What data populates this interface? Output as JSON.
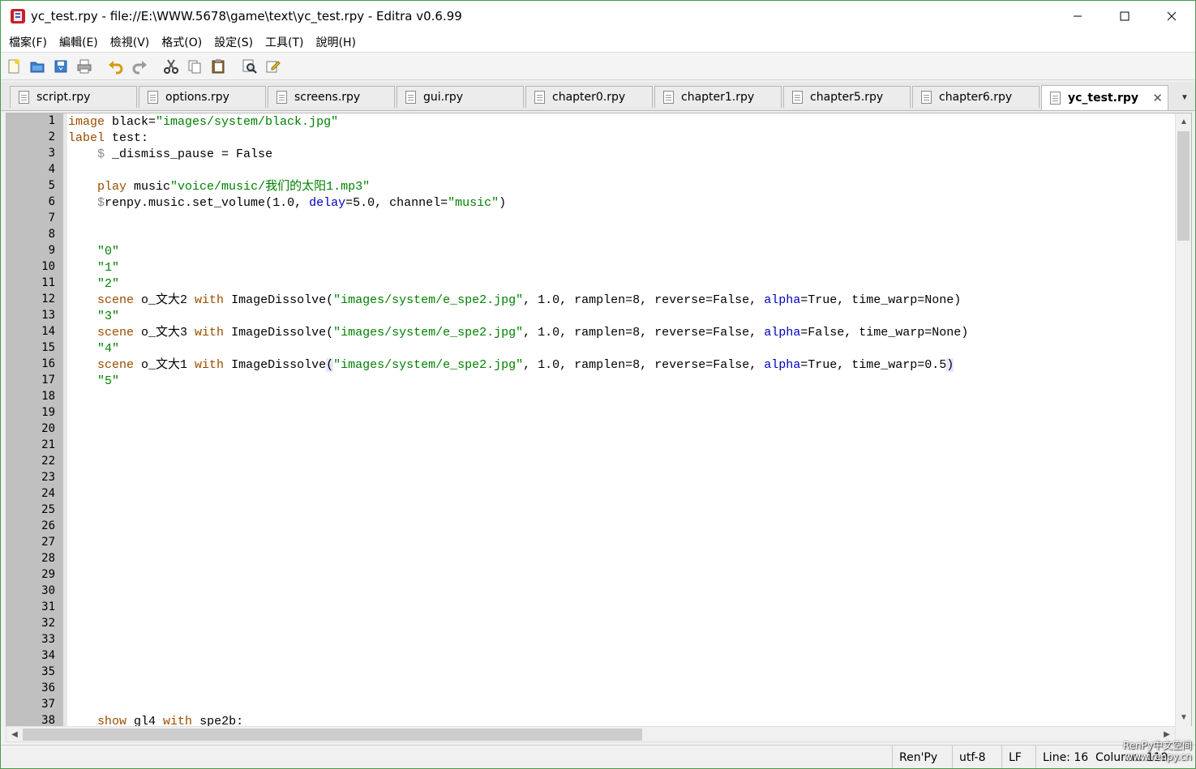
{
  "window": {
    "title": "yc_test.rpy - file://E:\\WWW.5678\\game\\text\\yc_test.rpy - Editra v0.6.99"
  },
  "menu": [
    {
      "label": "檔案(F)"
    },
    {
      "label": "編輯(E)"
    },
    {
      "label": "檢視(V)"
    },
    {
      "label": "格式(O)"
    },
    {
      "label": "設定(S)"
    },
    {
      "label": "工具(T)"
    },
    {
      "label": "說明(H)"
    }
  ],
  "tabs": [
    {
      "label": "script.rpy",
      "active": false
    },
    {
      "label": "options.rpy",
      "active": false
    },
    {
      "label": "screens.rpy",
      "active": false
    },
    {
      "label": "gui.rpy",
      "active": false
    },
    {
      "label": "chapter0.rpy",
      "active": false
    },
    {
      "label": "chapter1.rpy",
      "active": false
    },
    {
      "label": "chapter5.rpy",
      "active": false
    },
    {
      "label": "chapter6.rpy",
      "active": false
    },
    {
      "label": "yc_test.rpy",
      "active": true
    }
  ],
  "editor": {
    "line_numbers": [
      "1",
      "2",
      "3",
      "4",
      "5",
      "6",
      "7",
      "8",
      "9",
      "10",
      "11",
      "12",
      "13",
      "14",
      "15",
      "16",
      "17",
      "18",
      "19",
      "20",
      "21",
      "22",
      "23",
      "24",
      "25",
      "26",
      "27",
      "28",
      "29",
      "30",
      "31",
      "32",
      "33",
      "34",
      "35",
      "36",
      "37",
      "38"
    ],
    "lines": [
      {
        "n": 1,
        "tokens": [
          [
            "kw",
            "image"
          ],
          [
            "fn",
            " black="
          ],
          [
            "str",
            "\"images/system/black.jpg\""
          ]
        ]
      },
      {
        "n": 2,
        "tokens": [
          [
            "kw",
            "label"
          ],
          [
            "fn",
            " test:"
          ]
        ]
      },
      {
        "n": 3,
        "tokens": [
          [
            "fn",
            "    "
          ],
          [
            "var",
            "$"
          ],
          [
            "fn",
            " _dismiss_pause = False"
          ]
        ]
      },
      {
        "n": 5,
        "tokens": [
          [
            "fn",
            "    "
          ],
          [
            "kw",
            "play"
          ],
          [
            "fn",
            " music"
          ],
          [
            "str",
            "\"voice/music/我们的太阳1.mp3\""
          ]
        ]
      },
      {
        "n": 6,
        "tokens": [
          [
            "fn",
            "    "
          ],
          [
            "var",
            "$"
          ],
          [
            "fn",
            "renpy.music.set_volume(1.0, "
          ],
          [
            "bi",
            "delay"
          ],
          [
            "fn",
            "=5.0, channel="
          ],
          [
            "str",
            "\"music\""
          ],
          [
            "fn",
            ")"
          ]
        ]
      },
      {
        "n": 9,
        "tokens": [
          [
            "fn",
            "    "
          ],
          [
            "str",
            "\"0\""
          ]
        ]
      },
      {
        "n": 10,
        "tokens": [
          [
            "fn",
            "    "
          ],
          [
            "str",
            "\"1\""
          ]
        ]
      },
      {
        "n": 11,
        "tokens": [
          [
            "fn",
            "    "
          ],
          [
            "str",
            "\"2\""
          ]
        ]
      },
      {
        "n": 12,
        "tokens": [
          [
            "fn",
            "    "
          ],
          [
            "kw",
            "scene"
          ],
          [
            "fn",
            " o_文大2 "
          ],
          [
            "kw",
            "with"
          ],
          [
            "fn",
            " ImageDissolve("
          ],
          [
            "str",
            "\"images/system/e_spe2.jpg\""
          ],
          [
            "fn",
            ", 1.0, ramplen=8, reverse=False, "
          ],
          [
            "bi",
            "alpha"
          ],
          [
            "fn",
            "=True, time_warp=None)"
          ]
        ]
      },
      {
        "n": 13,
        "tokens": [
          [
            "fn",
            "    "
          ],
          [
            "str",
            "\"3\""
          ]
        ]
      },
      {
        "n": 14,
        "tokens": [
          [
            "fn",
            "    "
          ],
          [
            "kw",
            "scene"
          ],
          [
            "fn",
            " o_文大3 "
          ],
          [
            "kw",
            "with"
          ],
          [
            "fn",
            " ImageDissolve("
          ],
          [
            "str",
            "\"images/system/e_spe2.jpg\""
          ],
          [
            "fn",
            ", 1.0, ramplen=8, reverse=False, "
          ],
          [
            "bi",
            "alpha"
          ],
          [
            "fn",
            "=False, time_warp=None)"
          ]
        ]
      },
      {
        "n": 15,
        "tokens": [
          [
            "fn",
            "    "
          ],
          [
            "str",
            "\"4\""
          ]
        ]
      },
      {
        "n": 16,
        "tokens": [
          [
            "fn",
            "    "
          ],
          [
            "kw",
            "scene"
          ],
          [
            "fn",
            " o_文大1 "
          ],
          [
            "kw",
            "with"
          ],
          [
            "fn",
            " ImageDissolve"
          ],
          [
            "brace",
            "("
          ],
          [
            "str",
            "\"images/system/e_spe2.jpg\""
          ],
          [
            "fn",
            ", 1.0, ramplen=8, reverse=False, "
          ],
          [
            "bi",
            "alpha"
          ],
          [
            "fn",
            "=True, time_warp=0.5"
          ],
          [
            "brace",
            ")"
          ]
        ]
      },
      {
        "n": 17,
        "tokens": [
          [
            "fn",
            "    "
          ],
          [
            "str",
            "\"5\""
          ]
        ]
      },
      {
        "n": 38,
        "tokens": [
          [
            "fn",
            "    "
          ],
          [
            "kw",
            "show"
          ],
          [
            "fn",
            " gl4 "
          ],
          [
            "kw",
            "with"
          ],
          [
            "fn",
            " spe2b:"
          ]
        ]
      }
    ]
  },
  "statusbar": {
    "lexer": "Ren'Py",
    "encoding": "utf-8",
    "eol": "LF",
    "position": "Line: 16  Column: 119"
  },
  "watermark": {
    "line1": "RenPy中文空间",
    "line2": "www.renpy.cn"
  },
  "colors": {
    "keyword": "#9a4b00",
    "string": "#008000",
    "builtin": "#0000c0",
    "gutter": "#c0c0c0",
    "border": "#4a9a4a"
  }
}
